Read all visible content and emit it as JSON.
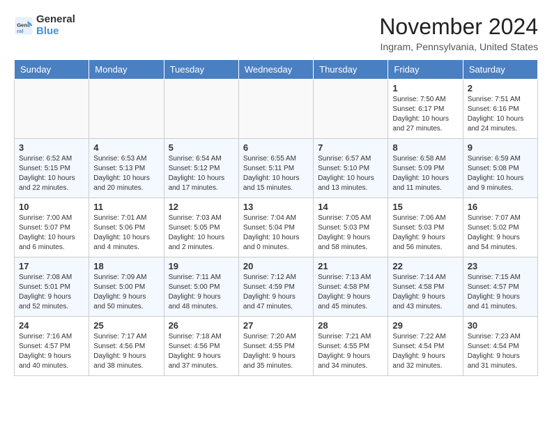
{
  "logo": {
    "line1": "General",
    "line2": "Blue"
  },
  "title": "November 2024",
  "location": "Ingram, Pennsylvania, United States",
  "days_of_week": [
    "Sunday",
    "Monday",
    "Tuesday",
    "Wednesday",
    "Thursday",
    "Friday",
    "Saturday"
  ],
  "weeks": [
    [
      {
        "day": "",
        "info": ""
      },
      {
        "day": "",
        "info": ""
      },
      {
        "day": "",
        "info": ""
      },
      {
        "day": "",
        "info": ""
      },
      {
        "day": "",
        "info": ""
      },
      {
        "day": "1",
        "info": "Sunrise: 7:50 AM\nSunset: 6:17 PM\nDaylight: 10 hours\nand 27 minutes."
      },
      {
        "day": "2",
        "info": "Sunrise: 7:51 AM\nSunset: 6:16 PM\nDaylight: 10 hours\nand 24 minutes."
      }
    ],
    [
      {
        "day": "3",
        "info": "Sunrise: 6:52 AM\nSunset: 5:15 PM\nDaylight: 10 hours\nand 22 minutes."
      },
      {
        "day": "4",
        "info": "Sunrise: 6:53 AM\nSunset: 5:13 PM\nDaylight: 10 hours\nand 20 minutes."
      },
      {
        "day": "5",
        "info": "Sunrise: 6:54 AM\nSunset: 5:12 PM\nDaylight: 10 hours\nand 17 minutes."
      },
      {
        "day": "6",
        "info": "Sunrise: 6:55 AM\nSunset: 5:11 PM\nDaylight: 10 hours\nand 15 minutes."
      },
      {
        "day": "7",
        "info": "Sunrise: 6:57 AM\nSunset: 5:10 PM\nDaylight: 10 hours\nand 13 minutes."
      },
      {
        "day": "8",
        "info": "Sunrise: 6:58 AM\nSunset: 5:09 PM\nDaylight: 10 hours\nand 11 minutes."
      },
      {
        "day": "9",
        "info": "Sunrise: 6:59 AM\nSunset: 5:08 PM\nDaylight: 10 hours\nand 9 minutes."
      }
    ],
    [
      {
        "day": "10",
        "info": "Sunrise: 7:00 AM\nSunset: 5:07 PM\nDaylight: 10 hours\nand 6 minutes."
      },
      {
        "day": "11",
        "info": "Sunrise: 7:01 AM\nSunset: 5:06 PM\nDaylight: 10 hours\nand 4 minutes."
      },
      {
        "day": "12",
        "info": "Sunrise: 7:03 AM\nSunset: 5:05 PM\nDaylight: 10 hours\nand 2 minutes."
      },
      {
        "day": "13",
        "info": "Sunrise: 7:04 AM\nSunset: 5:04 PM\nDaylight: 10 hours\nand 0 minutes."
      },
      {
        "day": "14",
        "info": "Sunrise: 7:05 AM\nSunset: 5:03 PM\nDaylight: 9 hours\nand 58 minutes."
      },
      {
        "day": "15",
        "info": "Sunrise: 7:06 AM\nSunset: 5:03 PM\nDaylight: 9 hours\nand 56 minutes."
      },
      {
        "day": "16",
        "info": "Sunrise: 7:07 AM\nSunset: 5:02 PM\nDaylight: 9 hours\nand 54 minutes."
      }
    ],
    [
      {
        "day": "17",
        "info": "Sunrise: 7:08 AM\nSunset: 5:01 PM\nDaylight: 9 hours\nand 52 minutes."
      },
      {
        "day": "18",
        "info": "Sunrise: 7:09 AM\nSunset: 5:00 PM\nDaylight: 9 hours\nand 50 minutes."
      },
      {
        "day": "19",
        "info": "Sunrise: 7:11 AM\nSunset: 5:00 PM\nDaylight: 9 hours\nand 48 minutes."
      },
      {
        "day": "20",
        "info": "Sunrise: 7:12 AM\nSunset: 4:59 PM\nDaylight: 9 hours\nand 47 minutes."
      },
      {
        "day": "21",
        "info": "Sunrise: 7:13 AM\nSunset: 4:58 PM\nDaylight: 9 hours\nand 45 minutes."
      },
      {
        "day": "22",
        "info": "Sunrise: 7:14 AM\nSunset: 4:58 PM\nDaylight: 9 hours\nand 43 minutes."
      },
      {
        "day": "23",
        "info": "Sunrise: 7:15 AM\nSunset: 4:57 PM\nDaylight: 9 hours\nand 41 minutes."
      }
    ],
    [
      {
        "day": "24",
        "info": "Sunrise: 7:16 AM\nSunset: 4:57 PM\nDaylight: 9 hours\nand 40 minutes."
      },
      {
        "day": "25",
        "info": "Sunrise: 7:17 AM\nSunset: 4:56 PM\nDaylight: 9 hours\nand 38 minutes."
      },
      {
        "day": "26",
        "info": "Sunrise: 7:18 AM\nSunset: 4:56 PM\nDaylight: 9 hours\nand 37 minutes."
      },
      {
        "day": "27",
        "info": "Sunrise: 7:20 AM\nSunset: 4:55 PM\nDaylight: 9 hours\nand 35 minutes."
      },
      {
        "day": "28",
        "info": "Sunrise: 7:21 AM\nSunset: 4:55 PM\nDaylight: 9 hours\nand 34 minutes."
      },
      {
        "day": "29",
        "info": "Sunrise: 7:22 AM\nSunset: 4:54 PM\nDaylight: 9 hours\nand 32 minutes."
      },
      {
        "day": "30",
        "info": "Sunrise: 7:23 AM\nSunset: 4:54 PM\nDaylight: 9 hours\nand 31 minutes."
      }
    ]
  ]
}
